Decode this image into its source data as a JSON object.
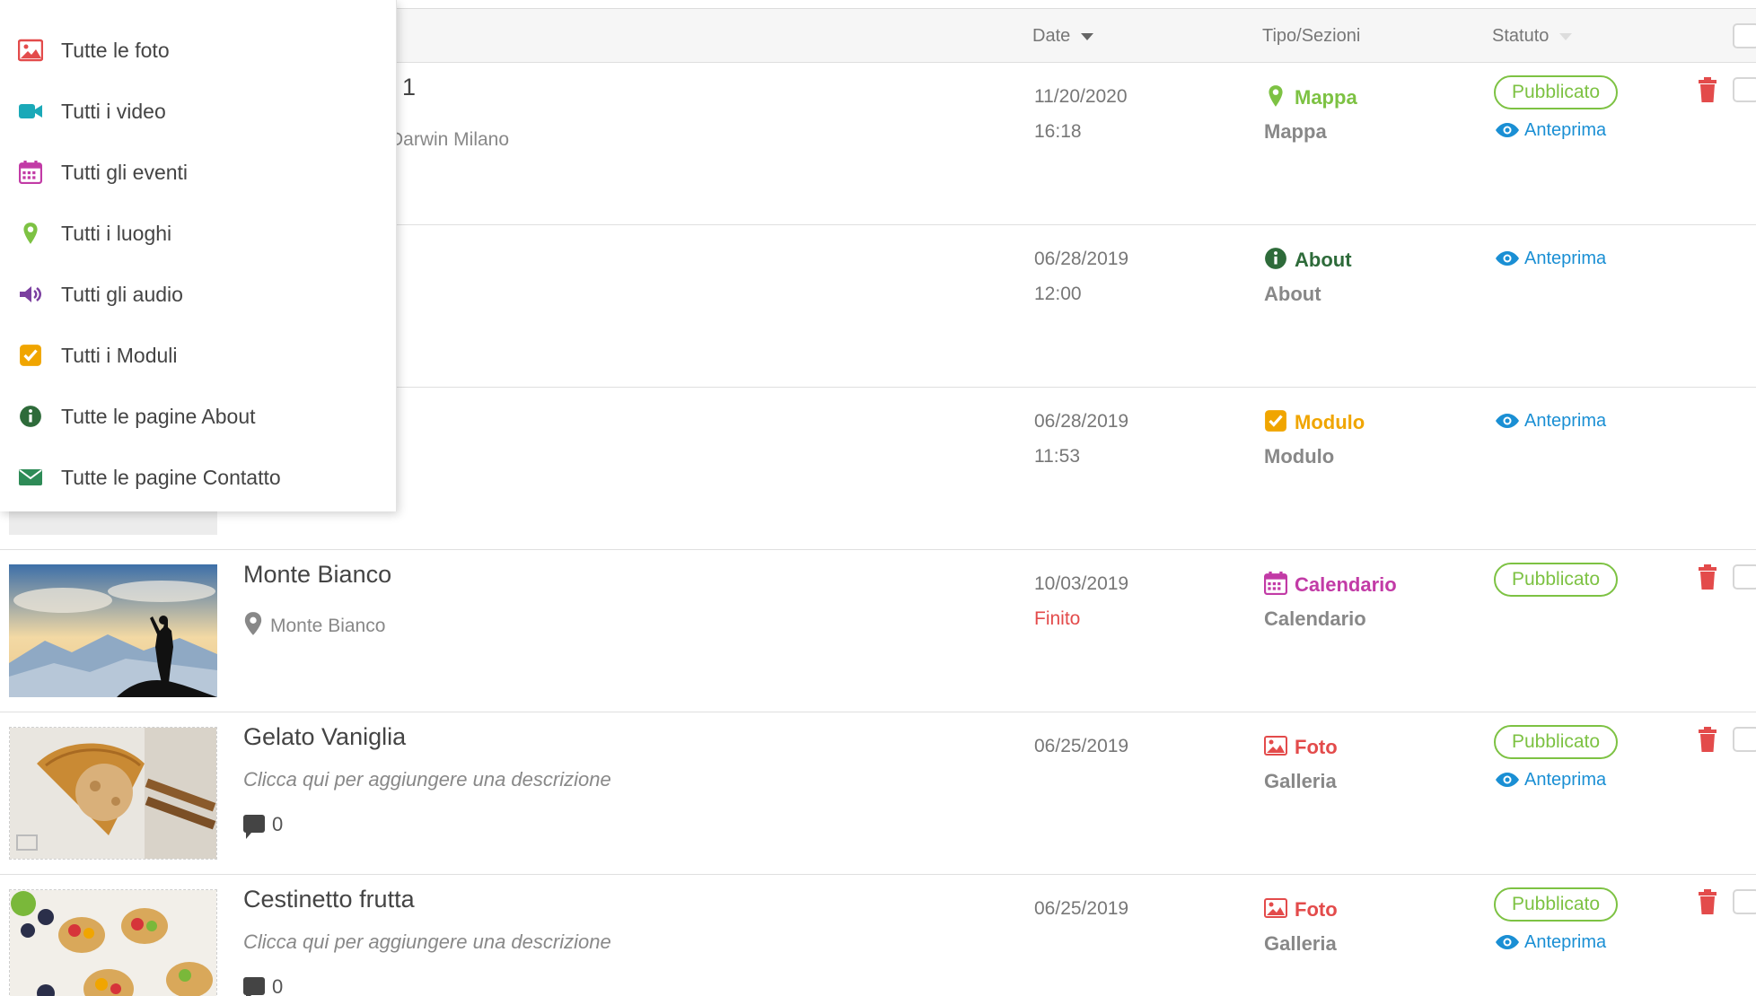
{
  "colors": {
    "green": "#7dc243",
    "blue": "#1a8fd4",
    "red": "#e34b4b",
    "pink": "#c23ba6",
    "orange": "#f0a500",
    "darkgreen": "#2e6b3a"
  },
  "header": {
    "date_label": "Date",
    "type_label": "Tipo/Sezioni",
    "status_label": "Statuto"
  },
  "menu": {
    "items": [
      {
        "label": "Tutte le foto",
        "icon": "photo-icon"
      },
      {
        "label": "Tutti i video",
        "icon": "video-icon"
      },
      {
        "label": "Tutti gli eventi",
        "icon": "calendar-icon"
      },
      {
        "label": "Tutti i luoghi",
        "icon": "map-pin-icon"
      },
      {
        "label": "Tutti gli audio",
        "icon": "audio-icon"
      },
      {
        "label": "Tutti i Moduli",
        "icon": "checkbox-icon"
      },
      {
        "label": "Tutte le pagine About",
        "icon": "info-icon"
      },
      {
        "label": "Tutte le pagine Contatto",
        "icon": "envelope-icon"
      }
    ]
  },
  "rows": [
    {
      "title_fragment": "1",
      "subline_fragment": "Darwin Milano",
      "date": "11/20/2020",
      "time": "16:18",
      "type": "Mappa",
      "section": "Mappa",
      "status": "Pubblicato",
      "preview": "Anteprima"
    },
    {
      "date": "06/28/2019",
      "time": "12:00",
      "type": "About",
      "section": "About",
      "preview": "Anteprima"
    },
    {
      "date": "06/28/2019",
      "time": "11:53",
      "type": "Modulo",
      "section": "Modulo",
      "preview": "Anteprima"
    },
    {
      "title": "Monte Bianco",
      "location": "Monte Bianco",
      "date": "10/03/2019",
      "state": "Finito",
      "type": "Calendario",
      "section": "Calendario",
      "status": "Pubblicato"
    },
    {
      "title": "Gelato Vaniglia",
      "description": "Clicca qui per aggiungere una descrizione",
      "comments": "0",
      "date": "06/25/2019",
      "type": "Foto",
      "section": "Galleria",
      "status": "Pubblicato",
      "preview": "Anteprima"
    },
    {
      "title": "Cestinetto frutta",
      "description": "Clicca qui per aggiungere una descrizione",
      "comments": "0",
      "date": "06/25/2019",
      "type": "Foto",
      "section": "Galleria",
      "status": "Pubblicato",
      "preview": "Anteprima"
    }
  ]
}
